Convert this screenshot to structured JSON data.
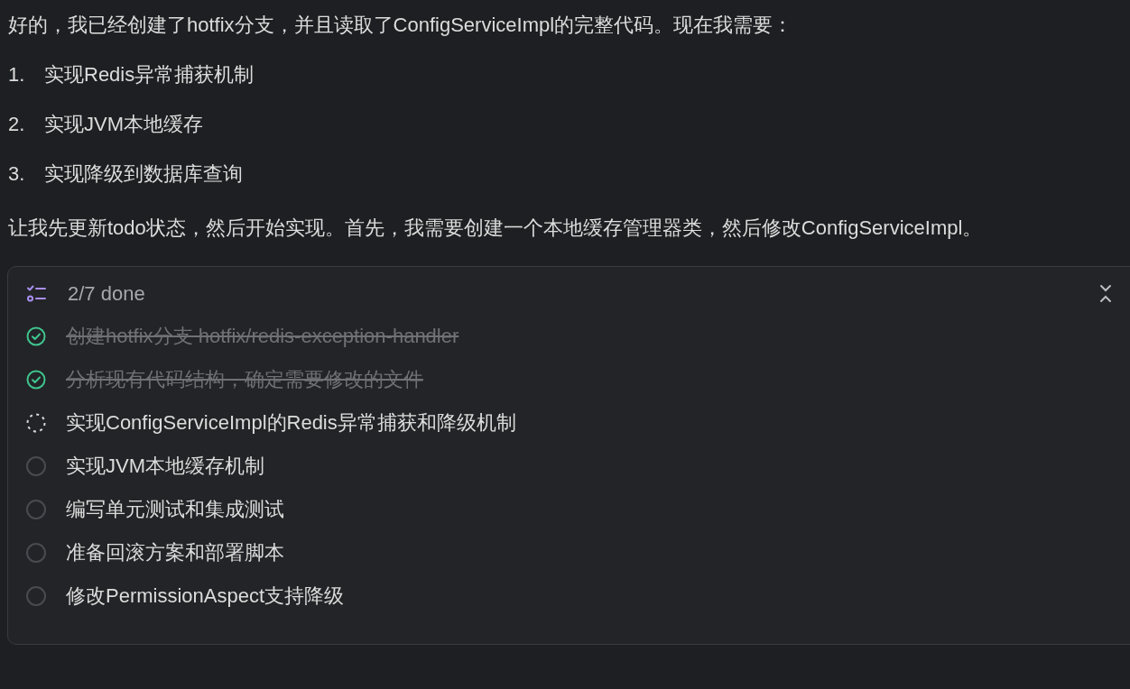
{
  "intro": "好的，我已经创建了hotfix分支，并且读取了ConfigServiceImpl的完整代码。现在我需要：",
  "steps": [
    {
      "number": "1.",
      "text": "实现Redis异常捕获机制"
    },
    {
      "number": "2.",
      "text": "实现JVM本地缓存"
    },
    {
      "number": "3.",
      "text": "实现降级到数据库查询"
    }
  ],
  "followup": "让我先更新todo状态，然后开始实现。首先，我需要创建一个本地缓存管理器类，然后修改ConfigServiceImpl。",
  "todo": {
    "summary": "2/7 done",
    "expanded": true,
    "items": [
      {
        "kind": "done",
        "text": "创建hotfix分支 hotfix/redis-exception-handler"
      },
      {
        "kind": "done",
        "text": "分析现有代码结构，确定需要修改的文件"
      },
      {
        "kind": "in_progress",
        "text": "实现ConfigServiceImpl的Redis异常捕获和降级机制"
      },
      {
        "kind": "pending",
        "text": "实现JVM本地缓存机制"
      },
      {
        "kind": "pending",
        "text": "编写单元测试和集成测试"
      },
      {
        "kind": "pending",
        "text": "准备回滚方案和部署脚本"
      },
      {
        "kind": "pending",
        "text": "修改PermissionAspect支持降级"
      }
    ]
  }
}
